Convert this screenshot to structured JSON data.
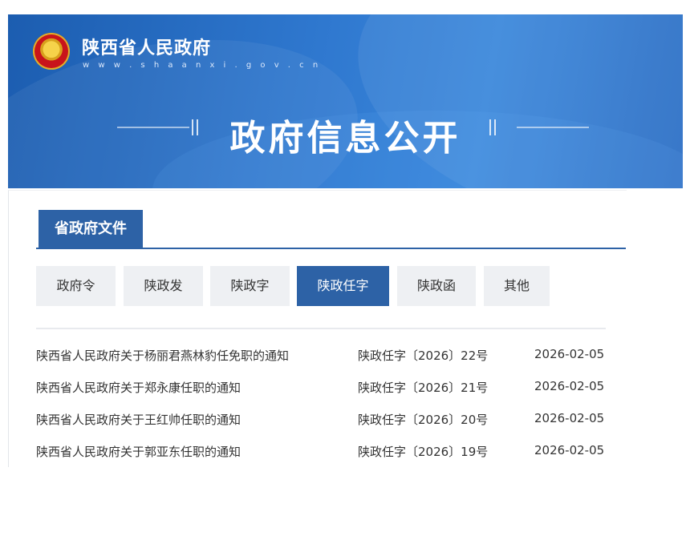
{
  "banner": {
    "site_name": "陕西省人民政府",
    "site_url": "w w w . s h a a n x i . g o v . c n",
    "title": "政府信息公开"
  },
  "section": {
    "tab_label": "省政府文件"
  },
  "filters": [
    {
      "label": "政府令",
      "active": false
    },
    {
      "label": "陕政发",
      "active": false
    },
    {
      "label": "陕政字",
      "active": false
    },
    {
      "label": "陕政任字",
      "active": true
    },
    {
      "label": "陕政函",
      "active": false
    },
    {
      "label": "其他",
      "active": false
    }
  ],
  "documents": [
    {
      "title": "陕西省人民政府关于杨丽君燕林豹任免职的通知",
      "number": "陕政任字〔2026〕22号",
      "date": "2026-02-05"
    },
    {
      "title": "陕西省人民政府关于郑永康任职的通知",
      "number": "陕政任字〔2026〕21号",
      "date": "2026-02-05"
    },
    {
      "title": "陕西省人民政府关于王红帅任职的通知",
      "number": "陕政任字〔2026〕20号",
      "date": "2026-02-05"
    },
    {
      "title": "陕西省人民政府关于郭亚东任职的通知",
      "number": "陕政任字〔2026〕19号",
      "date": "2026-02-05"
    }
  ]
}
